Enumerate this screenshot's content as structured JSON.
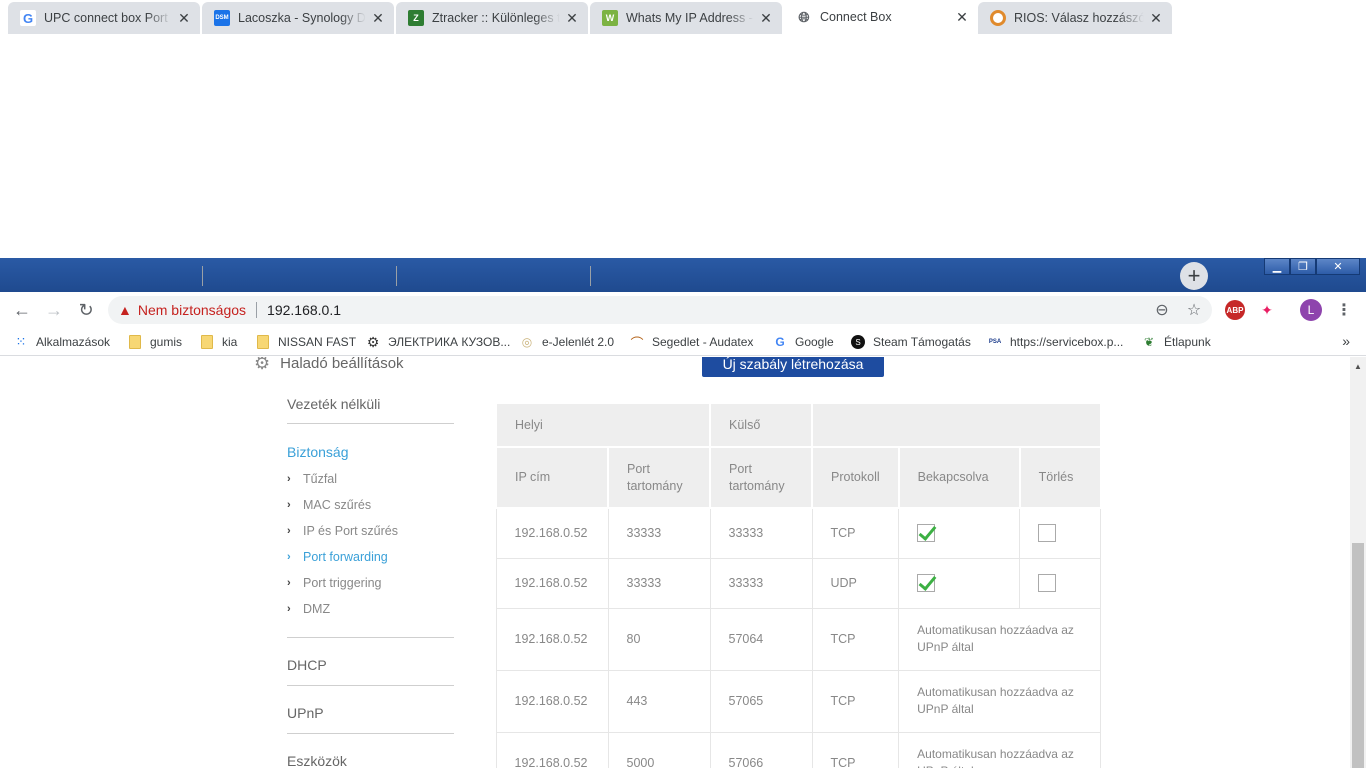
{
  "browser": {
    "tabs": [
      {
        "title": "UPC connect box Port ny",
        "favicon": "G",
        "favicon_color": "#4285f4"
      },
      {
        "title": "Lacoszka - Synology Disk",
        "favicon": "DSM",
        "favicon_color": "#1a73e8"
      },
      {
        "title": "Ztracker :: Különleges tar",
        "favicon": "Z",
        "favicon_color": "#2e7d32"
      },
      {
        "title": "Whats My IP Address - IP",
        "favicon": "W",
        "favicon_color": "#7cb342"
      },
      {
        "title": "Connect Box",
        "favicon": "globe",
        "favicon_color": "#5f6368"
      },
      {
        "title": "RIOS: Válasz hozzászólás",
        "favicon": "R",
        "favicon_color": "#e08a2c"
      }
    ],
    "address": {
      "security_label": "Nem biztonságos",
      "url": "192.168.0.1"
    },
    "avatar_letter": "L",
    "extension_abp": "ABP",
    "bookmarks": [
      {
        "label": "Alkalmazások",
        "icon": "apps-grid-icon"
      },
      {
        "label": "gumis",
        "icon": "folder-icon"
      },
      {
        "label": "kia",
        "icon": "folder-icon"
      },
      {
        "label": "NISSAN FAST",
        "icon": "folder-icon"
      },
      {
        "label": "ЭЛЕКТРИКА КУЗОВ...",
        "icon": "gear-icon"
      },
      {
        "label": "e-Jelenlét 2.0",
        "icon": "circle-icon"
      },
      {
        "label": "Segedlet - Audatex",
        "icon": "swoosh-icon"
      },
      {
        "label": "Google",
        "icon": "google-icon"
      },
      {
        "label": "Steam Támogatás",
        "icon": "steam-icon"
      },
      {
        "label": "https://servicebox.p...",
        "icon": "psa-icon"
      },
      {
        "label": "Étlapunk",
        "icon": "leaf-icon"
      }
    ],
    "bookmarks_more": "»"
  },
  "page": {
    "section_title": "Haladó beállítások",
    "create_button": "Új szabály létrehozása",
    "sidebar": {
      "wireless": "Vezeték nélküli",
      "security": "Biztonság",
      "security_items": [
        "Tűzfal",
        "MAC szűrés",
        "IP és Port szűrés",
        "Port forwarding",
        "Port triggering",
        "DMZ"
      ],
      "active_item": "Port forwarding",
      "dhcp": "DHCP",
      "upnp": "UPnP",
      "tools": "Eszközök"
    },
    "table": {
      "group_local": "Helyi",
      "group_external": "Külső",
      "col_ip": "IP cím",
      "col_port_local_1": "Port",
      "col_port_local_2": "tartomány",
      "col_port_ext_1": "Port",
      "col_port_ext_2": "tartomány",
      "col_protocol": "Protokoll",
      "col_enabled": "Bekapcsolva",
      "col_delete": "Törlés",
      "upnp_note_1": "Automatikusan hozzáadva az",
      "upnp_note_2": "UPnP által",
      "rows": [
        {
          "ip": "192.168.0.52",
          "local": "33333",
          "external": "33333",
          "protocol": "TCP",
          "enabled": true,
          "delete": false
        },
        {
          "ip": "192.168.0.52",
          "local": "33333",
          "external": "33333",
          "protocol": "UDP",
          "enabled": true,
          "delete": false
        },
        {
          "ip": "192.168.0.52",
          "local": "80",
          "external": "57064",
          "protocol": "TCP",
          "upnp": true
        },
        {
          "ip": "192.168.0.52",
          "local": "443",
          "external": "57065",
          "protocol": "TCP",
          "upnp": true
        },
        {
          "ip": "192.168.0.52",
          "local": "5000",
          "external": "57066",
          "protocol": "TCP",
          "upnp": true
        }
      ]
    }
  }
}
